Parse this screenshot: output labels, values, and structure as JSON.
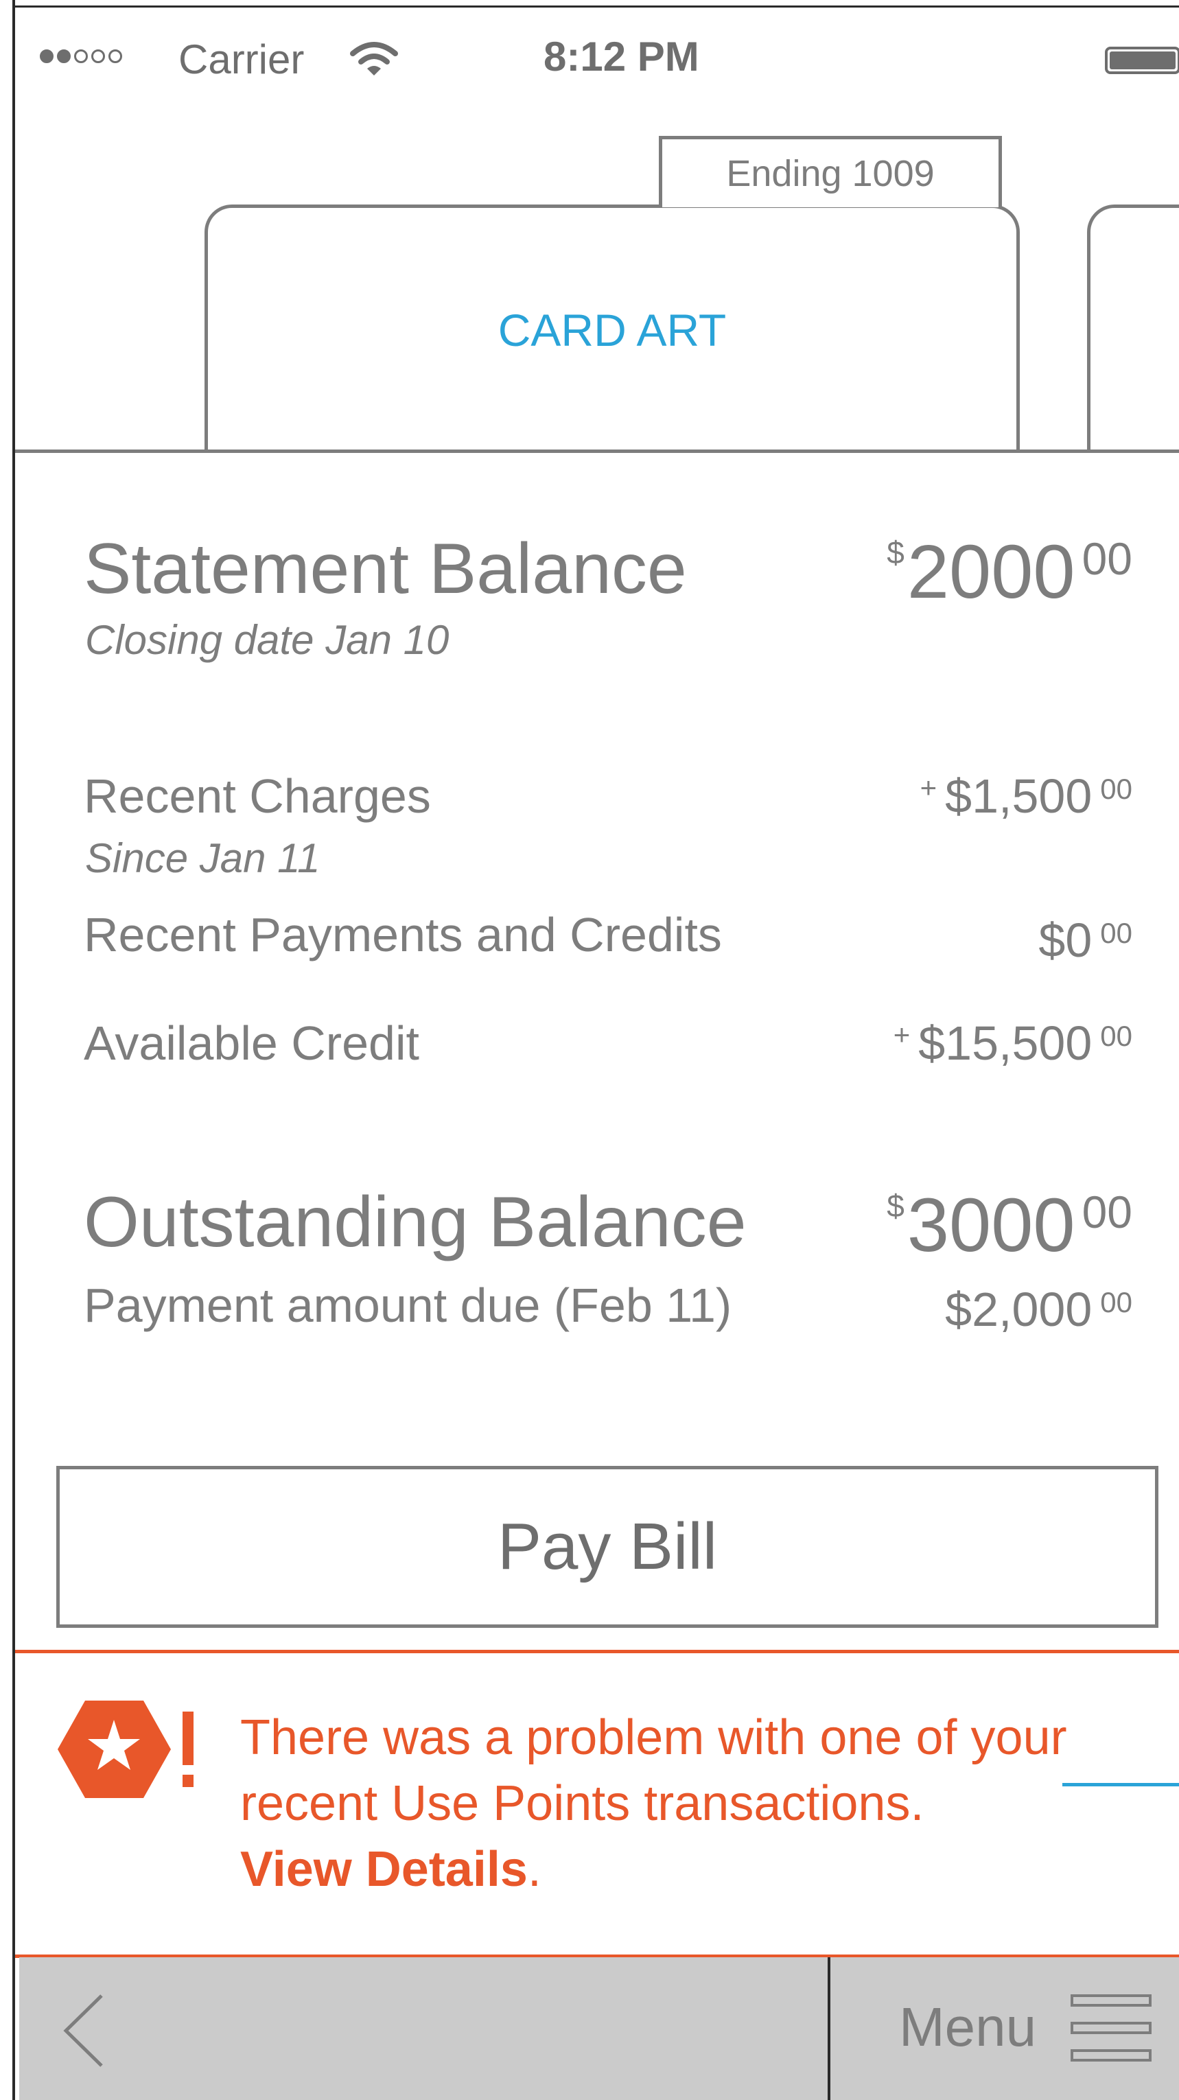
{
  "status_bar": {
    "carrier": "Carrier",
    "time": "8:12 PM",
    "signal_bars_filled": 2,
    "signal_bars_total": 5
  },
  "card": {
    "ending_label": "Ending 1009",
    "art_label": "CARD ART",
    "art_label_color": "#2aa3d8"
  },
  "statement": {
    "title": "Statement Balance",
    "subtitle": "Closing date Jan 10",
    "currency": "$",
    "amount_whole": "2000",
    "amount_cents": "00"
  },
  "recent_charges": {
    "label": "Recent Charges",
    "subtitle": "Since Jan 11",
    "prefix": "+",
    "amount": "$1,500",
    "cents": "00"
  },
  "recent_payments": {
    "label": "Recent Payments and Credits",
    "amount": "$0",
    "cents": "00"
  },
  "available_credit": {
    "label": "Available Credit",
    "prefix": "+",
    "amount": "$15,500",
    "cents": "00"
  },
  "outstanding": {
    "title": "Outstanding Balance",
    "currency": "$",
    "amount_whole": "3000",
    "amount_cents": "00",
    "due_label": "Payment amount due (Feb 11)",
    "due_amount": "$2,000",
    "due_cents": "00"
  },
  "pay_button": {
    "label": "Pay Bill"
  },
  "alert": {
    "message": "There was a problem with one of your recent Use Points transactions.",
    "link_label": "View Details",
    "link_suffix": ".",
    "color": "#e8572a"
  },
  "bottom_bar": {
    "menu_label": "Menu"
  },
  "colors": {
    "text": "#7d7d7d",
    "accent_blue": "#2aa3d8",
    "alert_orange": "#e8572a",
    "bar_background": "#cbcbcb"
  }
}
